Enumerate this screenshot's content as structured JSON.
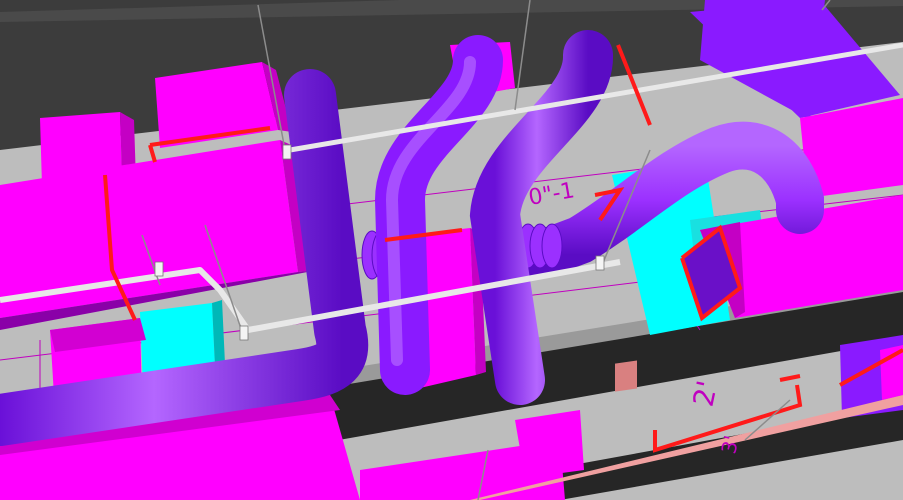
{
  "view": {
    "background": "#3a3a3a",
    "ceiling_color": "#bdbdbd",
    "beam_color": "#262626"
  },
  "colors": {
    "duct_magenta": "#ff00ff",
    "duct_magenta_shade": "#c400c4",
    "duct_violet": "#8a1aff",
    "duct_purple": "#9b30ff",
    "pipe_white": "#e8e8e8",
    "sprinkler_red": "#ff1a1a",
    "equipment_cyan": "#00ffff",
    "hanger_gray": "#8c8c8c",
    "annotation_magenta": "#c000c0"
  },
  "annotations": {
    "dim_1": "0\"-1",
    "dim_2": "2'",
    "dim_3": "3'"
  }
}
